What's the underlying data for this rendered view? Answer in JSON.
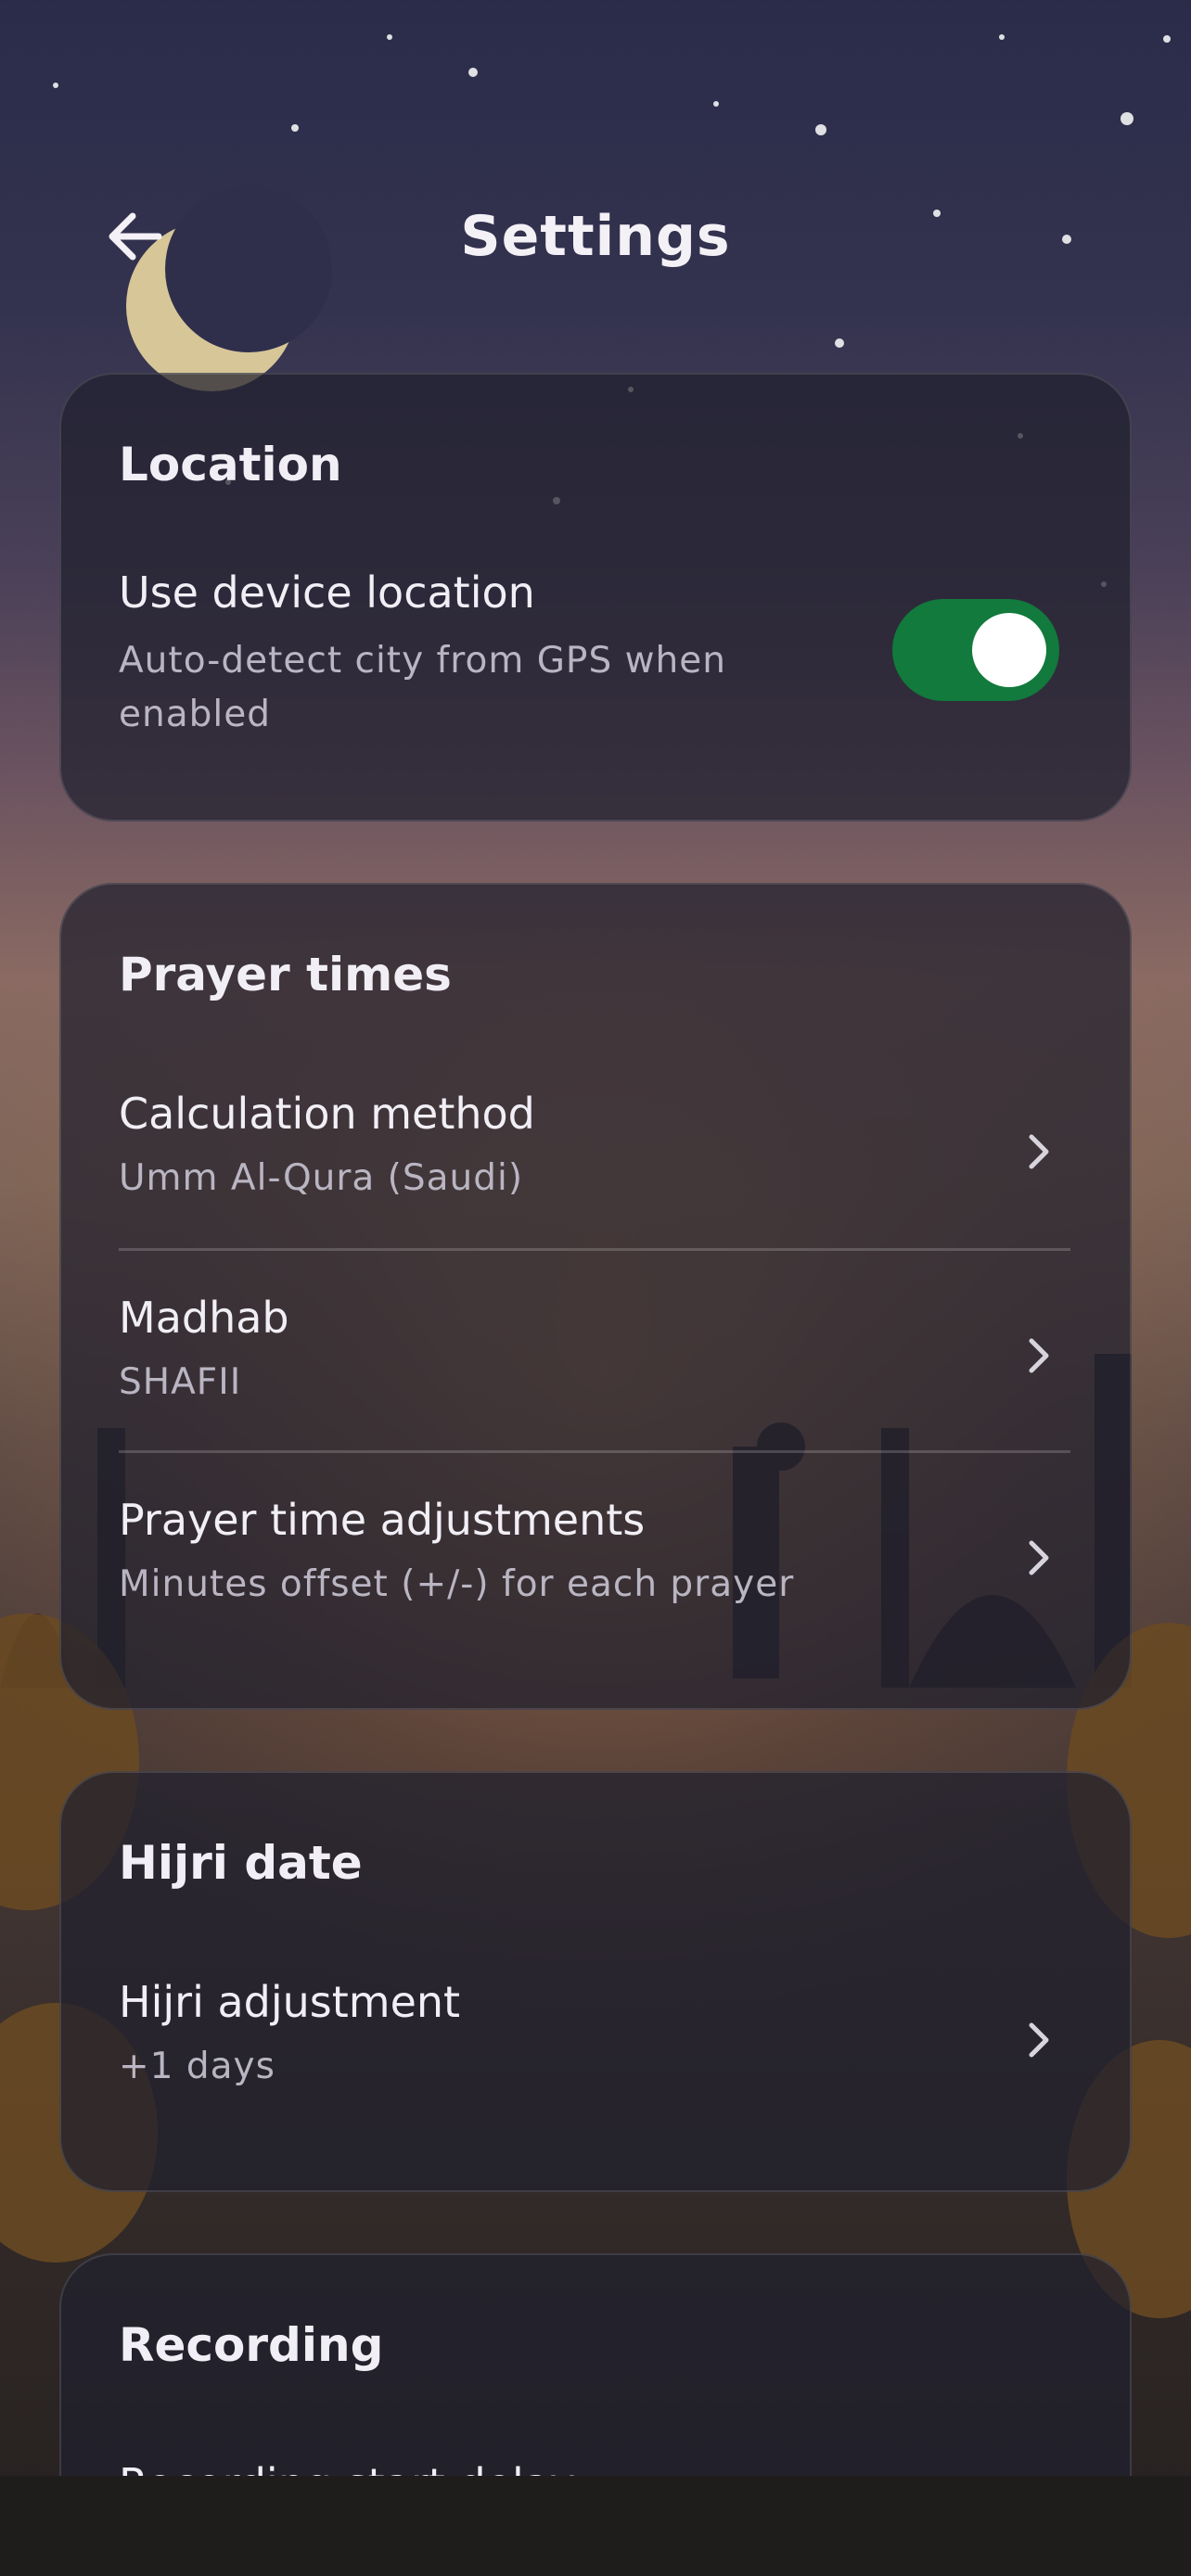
{
  "header": {
    "title": "Settings",
    "back_icon": "arrow-left-icon"
  },
  "location": {
    "title": "Location",
    "use_device_location": {
      "label": "Use device location",
      "description_line1": "Auto-detect city from GPS when",
      "description_line2": "enabled",
      "enabled": true
    }
  },
  "prayer_times": {
    "title": "Prayer times",
    "items": [
      {
        "label": "Calculation method",
        "value": "Umm Al-Qura (Saudi)"
      },
      {
        "label": "Madhab",
        "value": "SHAFII"
      },
      {
        "label": "Prayer time adjustments",
        "value": "Minutes offset (+/-) for each prayer"
      }
    ]
  },
  "hijri_date": {
    "title": "Hijri date",
    "items": [
      {
        "label": "Hijri adjustment",
        "value": "+1 days"
      }
    ]
  },
  "recording": {
    "title": "Recording",
    "items": [
      {
        "label": "Recording start delay"
      }
    ]
  },
  "colors": {
    "toggle_on": "#117a3c",
    "card_bg": "#20202e",
    "text_primary": "#f1eff5",
    "text_secondary": "#b9b5c2"
  }
}
